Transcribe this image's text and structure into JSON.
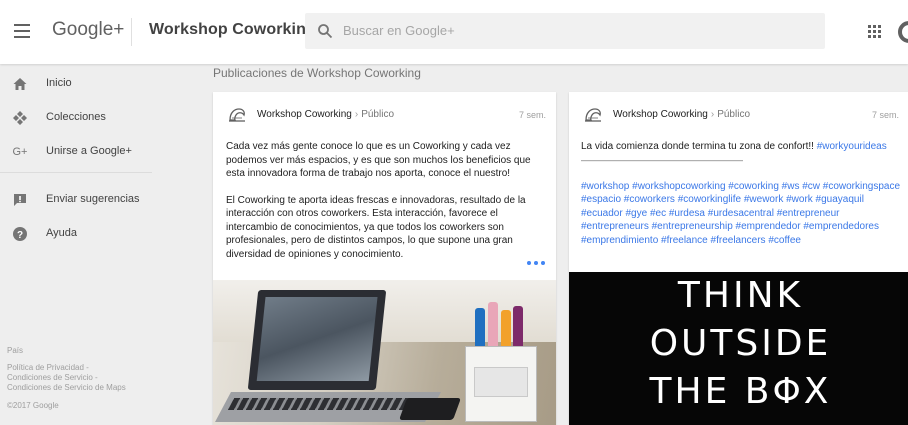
{
  "header": {
    "logo": "Google+",
    "page_title": "Workshop Coworking",
    "search_placeholder": "Buscar en Google+",
    "icons": [
      "menu-icon",
      "search-icon",
      "apps-icon",
      "account-icon"
    ]
  },
  "sidebar": {
    "items": [
      {
        "label": "Inicio",
        "icon": "home-icon"
      },
      {
        "label": "Colecciones",
        "icon": "collections-icon"
      },
      {
        "label": "Unirse a Google+",
        "icon": "google-plus-icon"
      },
      {
        "label": "Enviar sugerencias",
        "icon": "feedback-icon"
      },
      {
        "label": "Ayuda",
        "icon": "help-icon"
      }
    ],
    "footer": {
      "country": "País",
      "links": [
        "Política de Privacidad -",
        "Condiciones de Servicio -",
        "Condiciones de Servicio de Maps"
      ],
      "copyright": "©2017 Google"
    }
  },
  "main": {
    "section_title": "Publicaciones de Workshop Coworking",
    "posts": [
      {
        "author": "Workshop Coworking",
        "separator": "›",
        "visibility": "Público",
        "time": "7 sem.",
        "paragraph1": "Cada vez más gente conoce lo que es un Coworking y cada vez podemos ver más espacios, y es que son muchos los beneficios que esta innovadora forma de trabajo nos aporta, conoce el nuestro!",
        "paragraph2": "El Coworking te aporta ideas frescas e innovadoras, resultado de la interacción con otros coworkers. Esta interacción, favorece el intercambio de conocimientos, ya que todos los coworkers son profesionales, pero de distintos campos, lo que supone una gran diversidad de opiniones y conocimiento."
      },
      {
        "author": "Workshop Coworking",
        "separator": "›",
        "visibility": "Público",
        "time": "7 sem.",
        "text": "La vida comienza donde termina tu zona de confort!! ",
        "inline_hashtag": "#workyourideas",
        "divider": "——————————————————",
        "hashtags": "#workshop #workshopcoworking #coworking #ws #cw #coworkingspace #espacio #coworkers #coworkinglife #wework #work #guayaquil #ecuador #gye #ec #urdesa #urdesacentral #entrepreneur #entrepreneurs #entrepreneurship #emprendedor #emprendedores #emprendimiento #freelance #freelancers #coffee",
        "image_text": [
          "THINK",
          "OUTSIDE",
          "THE BΦX"
        ]
      }
    ]
  },
  "colors": {
    "background": "#eeeeee",
    "header": "#ffffff",
    "hashtag": "#3b78e7",
    "more_dots": "#4285f4",
    "image_background": "#060606"
  }
}
